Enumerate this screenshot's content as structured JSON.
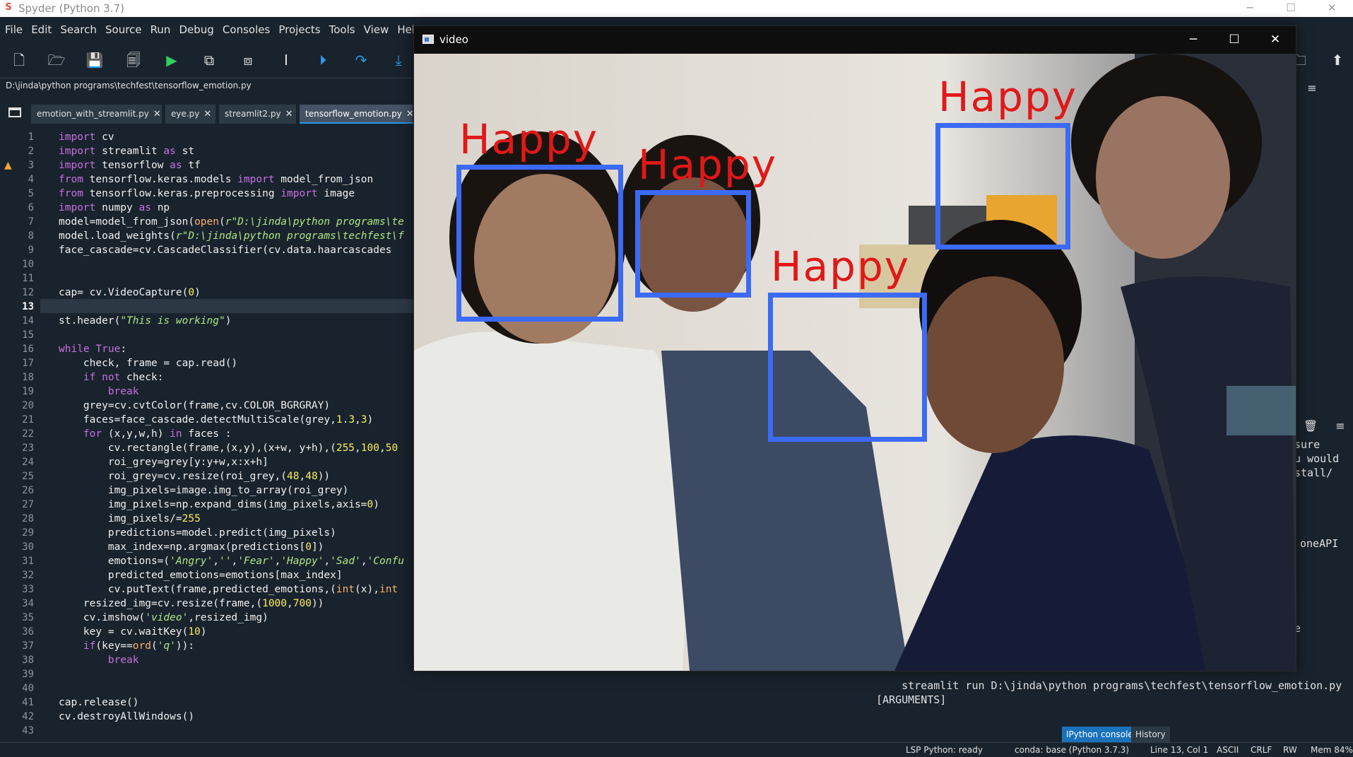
{
  "app": {
    "title": "Spyder (Python 3.7)"
  },
  "menu": [
    "File",
    "Edit",
    "Search",
    "Source",
    "Run",
    "Debug",
    "Consoles",
    "Projects",
    "Tools",
    "View",
    "Help"
  ],
  "editor": {
    "path": "D:\\jinda\\python programs\\techfest\\tensorflow_emotion.py",
    "tabs": [
      {
        "label": "emotion_with_streamlit.py",
        "close": "✕"
      },
      {
        "label": "eye.py",
        "close": "✕"
      },
      {
        "label": "streamlit2.py",
        "close": "✕"
      },
      {
        "label": "tensorflow_emotion.py",
        "close": "✕"
      }
    ],
    "active_tab": 3,
    "current_line": 13,
    "warning_line": 3,
    "line_numbers": [
      "1",
      "2",
      "3",
      "4",
      "5",
      "6",
      "7",
      "8",
      "9",
      "10",
      "11",
      "12",
      "13",
      "14",
      "15",
      "16",
      "17",
      "18",
      "19",
      "20",
      "21",
      "22",
      "23",
      "24",
      "25",
      "26",
      "27",
      "28",
      "29",
      "30",
      "31",
      "32",
      "33",
      "34",
      "35",
      "36",
      "37",
      "38",
      "39",
      "40",
      "41",
      "42",
      "43"
    ],
    "lines": [
      "import cv2",
      "import streamlit as st",
      "import tensorflow as tf",
      "from tensorflow.keras.models import model_from_json",
      "from tensorflow.keras.preprocessing import image",
      "import numpy as np",
      "model=model_from_json(open(r\"D:\\jinda\\python programs\\te",
      "model.load_weights(r\"D:\\jinda\\python programs\\techfest\\f",
      "face_cascade=cv2.CascadeClassifier(cv2.data.haarcascades",
      "",
      "",
      "cap= cv2.VideoCapture(0)",
      "",
      "st.header(\"This is working\")",
      "",
      "while True:",
      "    check, frame = cap.read()",
      "    if not check:",
      "        break",
      "    grey=cv2.cvtColor(frame,cv2.COLOR_BGR2GRAY)",
      "    faces=face_cascade.detectMultiScale(grey,1.3,3)",
      "    for (x,y,w,h) in faces :",
      "        cv2.rectangle(frame,(x,y),(x+w, y+h),(255,100,50",
      "        roi_grey=grey[y:y+w,x:x+h]",
      "        roi_grey=cv2.resize(roi_grey,(48,48))",
      "        img_pixels=image.img_to_array(roi_grey)",
      "        img_pixels=np.expand_dims(img_pixels,axis=0)",
      "        img_pixels/=255",
      "        predictions=model.predict(img_pixels)",
      "        max_index=np.argmax(predictions[0])",
      "        emotions=('Angry','','Fear','Happy','Sad','Confu",
      "        predicted_emotions=emotions[max_index]",
      "        cv2.putText(frame,predicted_emotions,(int(x),int",
      "    resized_img=cv2.resize(frame,(1000,700))",
      "    cv2.imshow('video',resized_img)",
      "    key = cv2.waitKey(10)",
      "    if(key==ord('q')):",
      "        break",
      "",
      "",
      "cap.release()",
      "cv2.destroyAllWindows()",
      ""
    ]
  },
  "video_window": {
    "title": "video",
    "detections": [
      "Happy",
      "Happy",
      "Happy",
      "Happy"
    ]
  },
  "console": {
    "command": "    streamlit run D:\\jinda\\python programs\\techfest\\tensorflow_emotion.py\n[ARGUMENTS]",
    "partial_text": [
      "sure",
      "u would",
      "stall/",
      "oneAPI",
      "e"
    ],
    "tabs": [
      "IPython console",
      "History"
    ]
  },
  "status": {
    "lsp": "LSP Python: ready",
    "conda": "conda: base (Python 3.7.3)",
    "position": "Line 13, Col 1",
    "encoding": "ASCII",
    "eol": "CRLF",
    "rw": "RW",
    "mem": "Mem 84%"
  },
  "window_controls": {
    "minimize": "─",
    "maximize": "☐",
    "close": "✕"
  }
}
